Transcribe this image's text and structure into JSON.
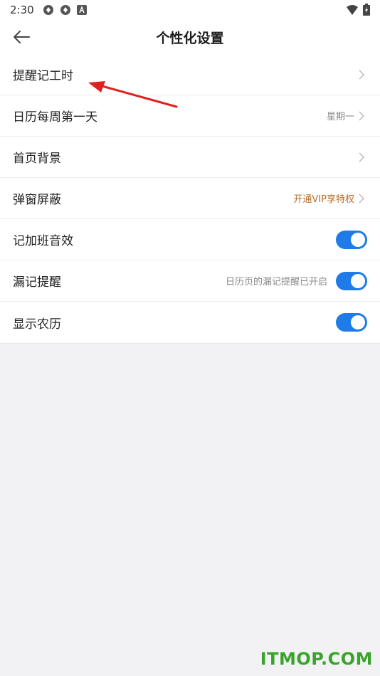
{
  "status_bar": {
    "time": "2:30",
    "icons": [
      "sync-icon",
      "sync-icon",
      "text-a-icon",
      "wifi-icon",
      "battery-icon"
    ]
  },
  "header": {
    "title": "个性化设置",
    "back_icon": "arrow-left-icon"
  },
  "settings": [
    {
      "label": "提醒记工时",
      "value": "",
      "control": "chevron"
    },
    {
      "label": "日历每周第一天",
      "value": "星期一",
      "control": "chevron"
    },
    {
      "label": "首页背景",
      "value": "",
      "control": "chevron"
    },
    {
      "label": "弹窗屏蔽",
      "value": "开通VIP享特权",
      "control": "chevron"
    },
    {
      "label": "记加班音效",
      "value": "",
      "control": "toggle",
      "on": true
    },
    {
      "label": "漏记提醒",
      "value": "日历页的漏记提醒已开启",
      "control": "toggle",
      "on": true
    },
    {
      "label": "显示农历",
      "value": "",
      "control": "toggle",
      "on": true
    }
  ],
  "colors": {
    "accent": "#1e7be8",
    "vip": "#b86d2a",
    "annotation": "#e02020",
    "watermark": "#3aa42a"
  },
  "watermark": "ITMOP.COM"
}
